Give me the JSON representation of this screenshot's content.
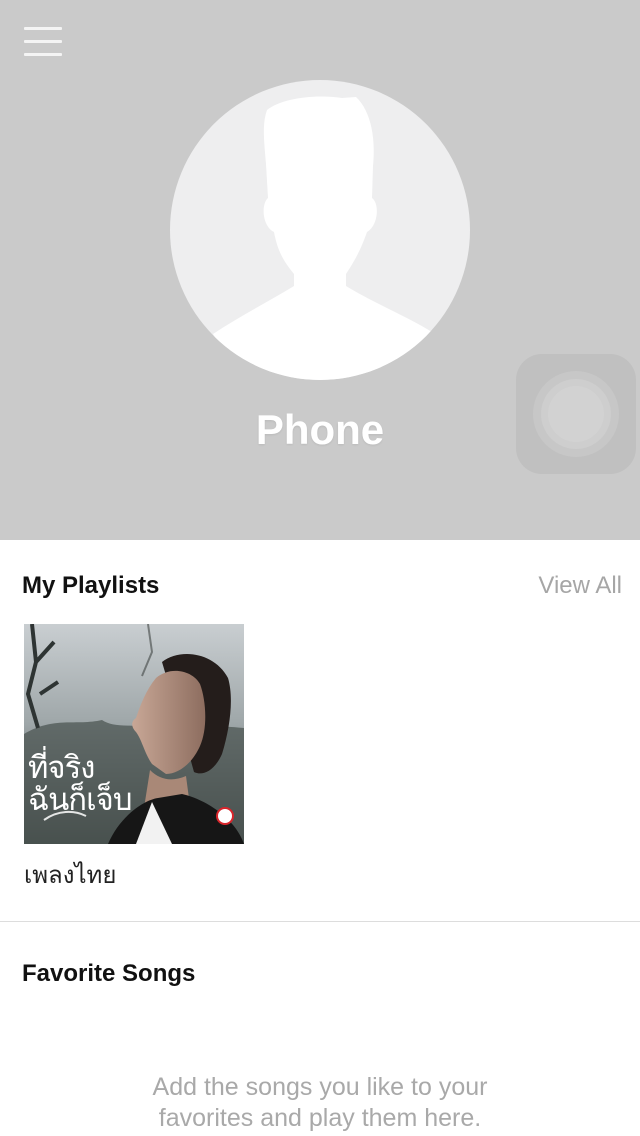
{
  "header": {
    "menu_icon": "hamburger-menu-icon",
    "avatar_icon": "default-user-silhouette-icon",
    "profile_name": "Phone",
    "background_color": "#cacaca"
  },
  "overlay": {
    "assistive_touch_icon": "assistive-touch-icon"
  },
  "playlists": {
    "title": "My Playlists",
    "view_all_label": "View All",
    "items": [
      {
        "name": "เพลงไทย",
        "cover_text_line1": "ที่จริง",
        "cover_text_line2": "ฉันก็เจ็บ"
      }
    ]
  },
  "favorites": {
    "title": "Favorite Songs",
    "empty_message_line1": "Add the songs you like to your",
    "empty_message_line2": "favorites and play them here."
  }
}
